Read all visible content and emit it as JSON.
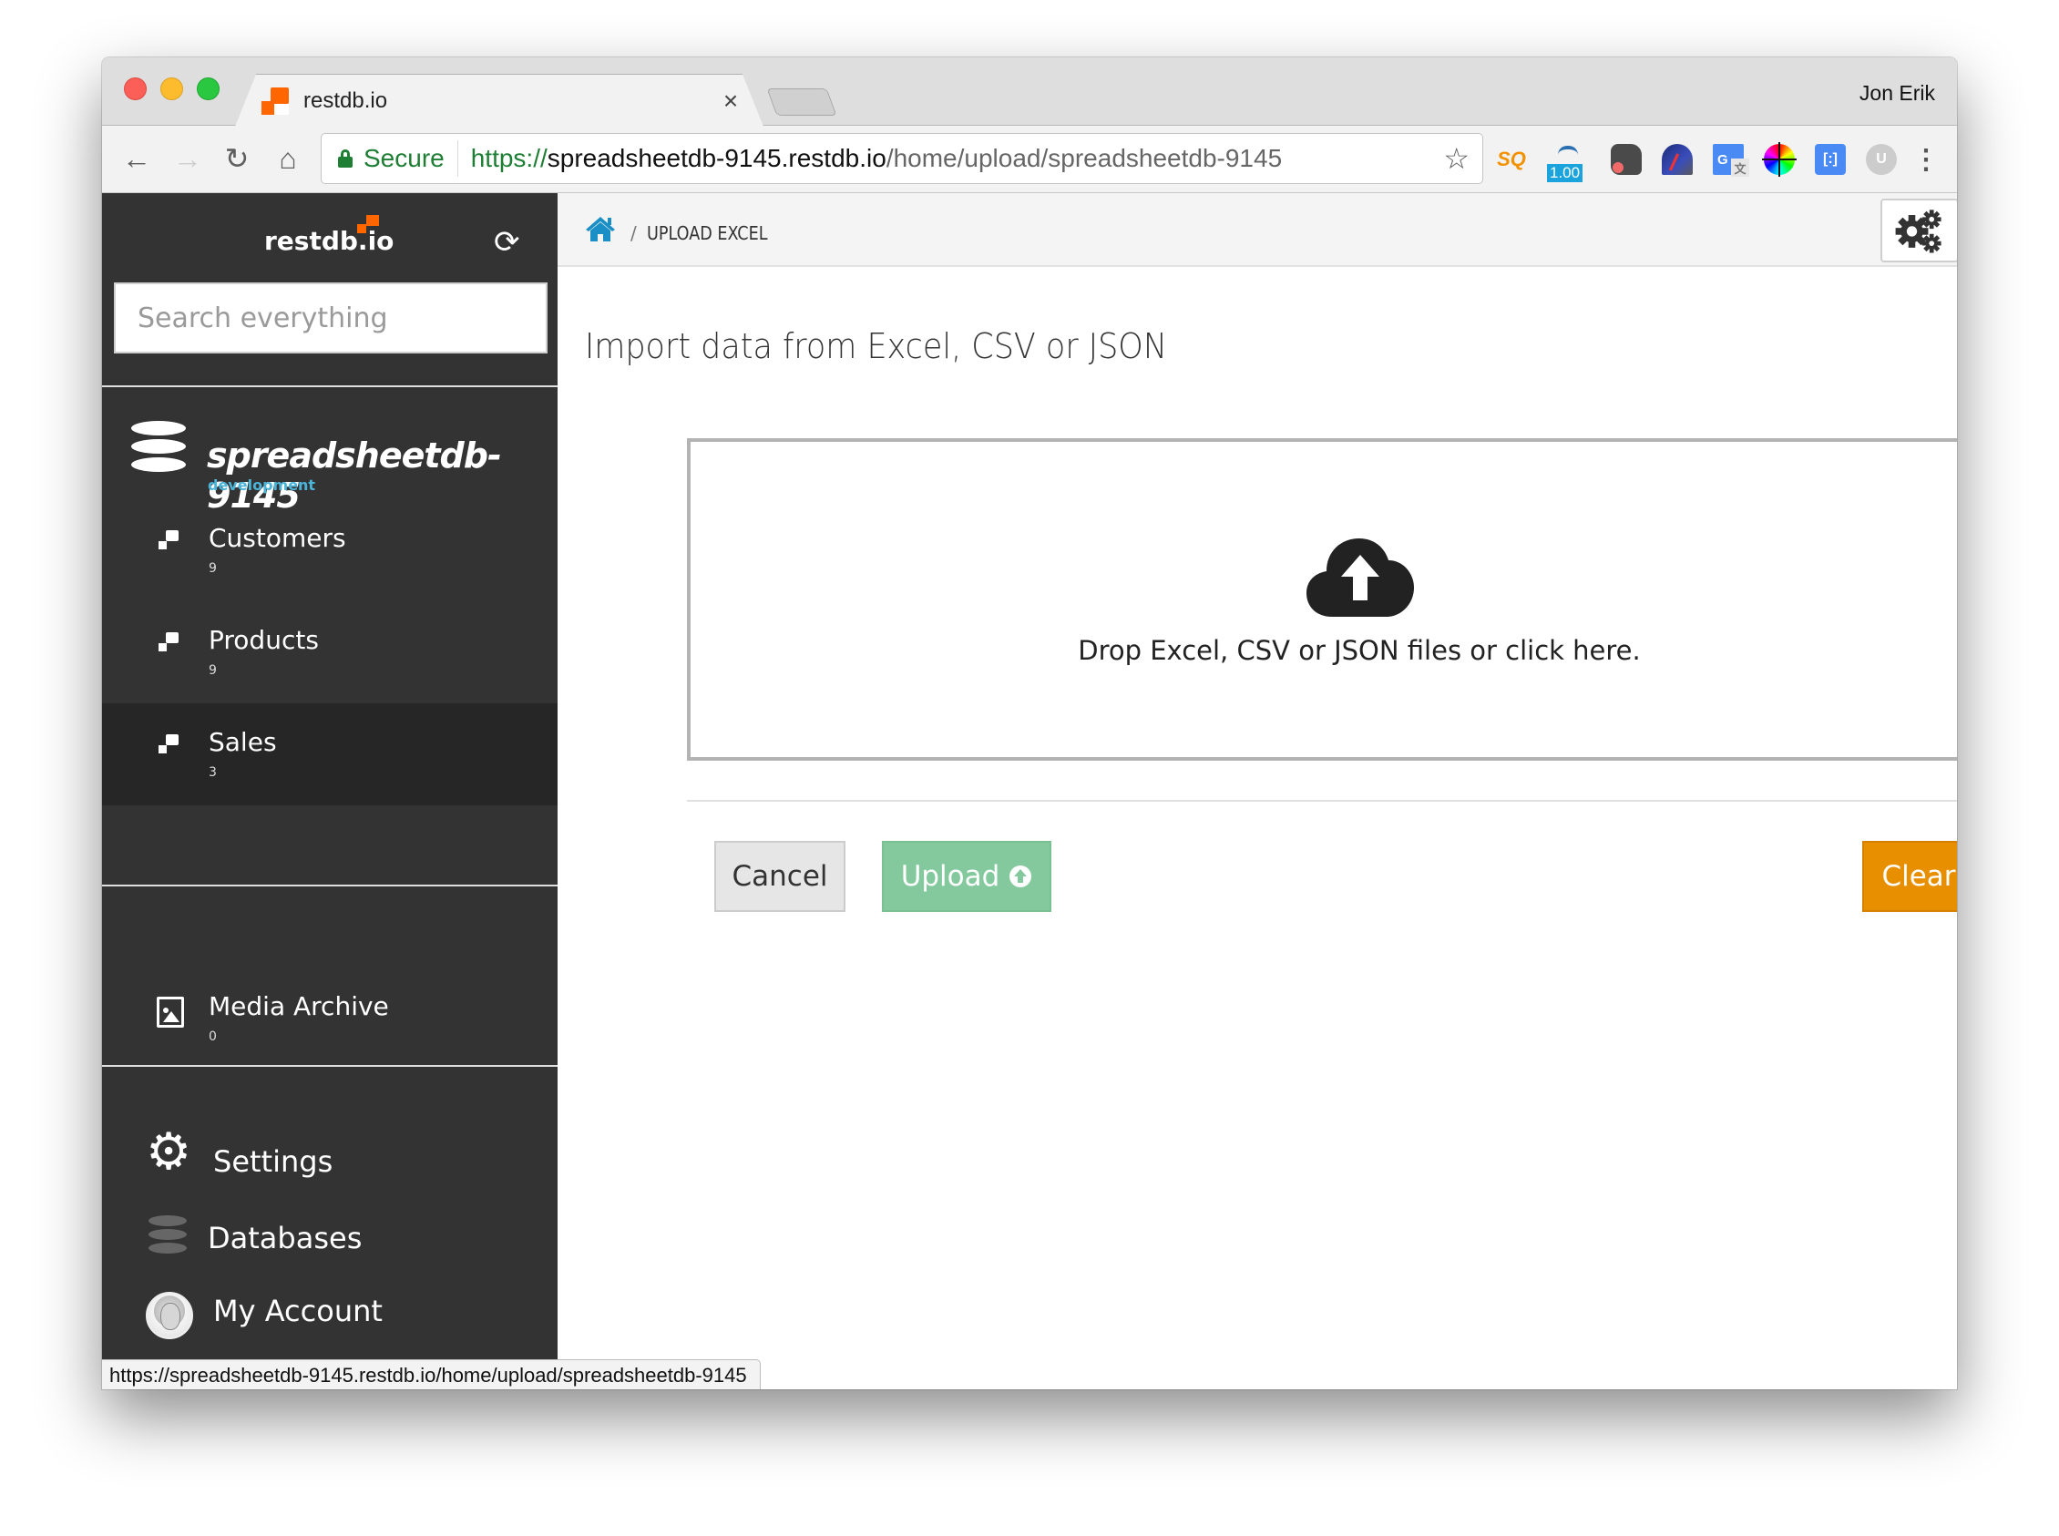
{
  "browser": {
    "tab_title": "restdb.io",
    "tab_close": "×",
    "profile_name": "Jon Erik",
    "secure_label": "Secure",
    "url_scheme": "https://",
    "url_host": "spreadsheetdb-9145.restdb.io",
    "url_path": "/home/upload/spreadsheetdb-9145",
    "extensions": [
      {
        "name": "sq-extension",
        "label": "SQ"
      },
      {
        "name": "rate-extension",
        "badge": "1.00"
      },
      {
        "name": "evernote-extension"
      },
      {
        "name": "speedtest-extension"
      },
      {
        "name": "google-translate-extension",
        "label": "G",
        "sub": "文"
      },
      {
        "name": "color-picker-extension"
      },
      {
        "name": "tag-extension",
        "label": "[:]"
      },
      {
        "name": "u-extension",
        "label": "U"
      }
    ],
    "status_url": "https://spreadsheetdb-9145.restdb.io/home/upload/spreadsheetdb-9145"
  },
  "sidebar": {
    "brand": "restdb.io",
    "search_placeholder": "Search everything",
    "database": {
      "name": "spreadsheetdb-9145",
      "environment": "development"
    },
    "collections": [
      {
        "label": "Customers",
        "count": "9",
        "active": false
      },
      {
        "label": "Products",
        "count": "9",
        "active": false
      },
      {
        "label": "Sales",
        "count": "3",
        "active": true
      }
    ],
    "media": {
      "label": "Media Archive",
      "count": "0"
    },
    "bottom": [
      {
        "label": "Settings",
        "icon": "gear-icon"
      },
      {
        "label": "Databases",
        "icon": "database-icon"
      },
      {
        "label": "My Account",
        "icon": "avatar"
      }
    ]
  },
  "main": {
    "breadcrumb": {
      "separator": "/",
      "current": "UPLOAD EXCEL"
    },
    "title": "Import data from Excel, CSV or JSON",
    "dropzone_text": "Drop Excel, CSV or JSON files or click here.",
    "buttons": {
      "cancel": "Cancel",
      "upload": "Upload",
      "clear": "Clear"
    },
    "colors": {
      "upload": "#84c99e",
      "clear": "#e88f00",
      "accent": "#1a8fc6"
    }
  }
}
